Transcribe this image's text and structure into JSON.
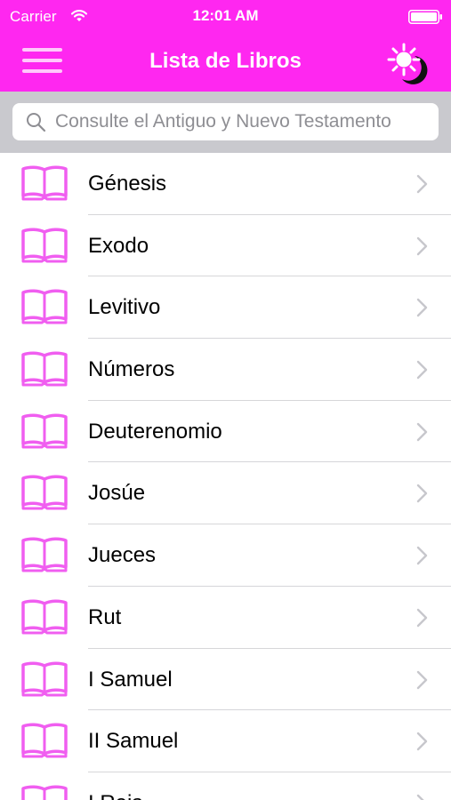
{
  "status_bar": {
    "carrier": "Carrier",
    "time": "12:01 AM",
    "wifi_icon": "wifi-icon",
    "battery_icon": "battery-icon"
  },
  "nav_bar": {
    "title": "Lista de Libros",
    "menu_icon": "hamburger-menu-icon",
    "theme_icon": "sun-moon-icon"
  },
  "search": {
    "placeholder": "Consulte el Antiguo y Nuevo Testamento",
    "value": "",
    "icon": "search-icon"
  },
  "books": {
    "icon": "open-book-icon",
    "accessory_icon": "chevron-right-icon",
    "items": [
      {
        "label": "Génesis"
      },
      {
        "label": "Exodo"
      },
      {
        "label": "Levitivo"
      },
      {
        "label": "Números"
      },
      {
        "label": "Deuterenomio"
      },
      {
        "label": "Josúe"
      },
      {
        "label": "Jueces"
      },
      {
        "label": "Rut"
      },
      {
        "label": "I Samuel"
      },
      {
        "label": "II Samuel"
      },
      {
        "label": "I Reis"
      }
    ]
  },
  "colors": {
    "brand": "#ff27f0",
    "book_icon": "#f05ef0",
    "search_bar_background": "#c9c9ce",
    "separator": "#d6d6d9",
    "chevron": "#c7c7cc"
  }
}
